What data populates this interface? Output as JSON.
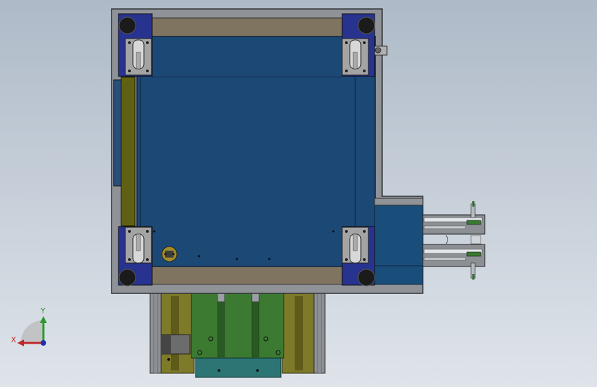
{
  "viewport": {
    "background_top": "#aebac8",
    "background_bottom": "#dfe4ea"
  },
  "colors": {
    "frame": "#8f9296",
    "frame_edge": "#2f3236",
    "plate": "#1c4876",
    "plate_edge": "#10233b",
    "corner_block": "#27338f",
    "rail": "#7f7460",
    "side_strip": "#606014",
    "mount_plate": "#a4a4a4",
    "foot": "#1b1b1b",
    "side_box": "#1a4e7a",
    "gripper_frame": "#8c9094",
    "bottom_olive": "#7d7a2a",
    "green_plate": "#3c7a32",
    "teal_block": "#2d7575",
    "motor_gray": "#6c6c6c",
    "cylinder_gold": "#a08c28"
  },
  "triad": {
    "x_label": "X",
    "y_label": "Y",
    "x_color": "#c0282c",
    "y_color": "#2a9a2a",
    "z_color": "#1f2fb0"
  }
}
